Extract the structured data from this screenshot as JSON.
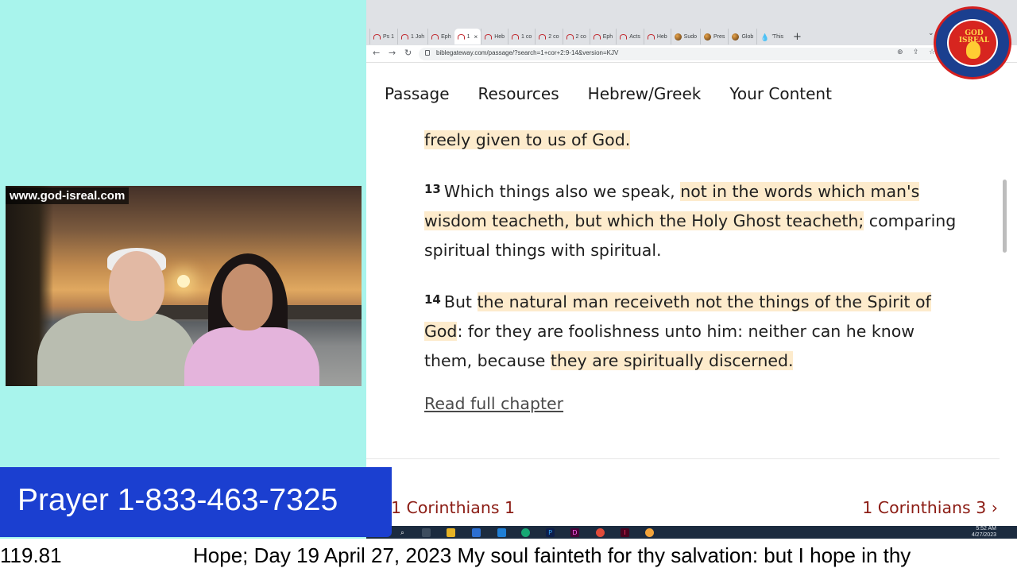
{
  "browser": {
    "tabs": [
      {
        "label": "Ps 1",
        "icon": "arc"
      },
      {
        "label": "1 Joh",
        "icon": "arc"
      },
      {
        "label": "Eph",
        "icon": "arc"
      },
      {
        "label": "1",
        "icon": "arc",
        "active": true
      },
      {
        "label": "Heb",
        "icon": "arc"
      },
      {
        "label": "1 co",
        "icon": "arc"
      },
      {
        "label": "2 co",
        "icon": "arc"
      },
      {
        "label": "2 co",
        "icon": "arc"
      },
      {
        "label": "Eph",
        "icon": "arc"
      },
      {
        "label": "Acts",
        "icon": "arc"
      },
      {
        "label": "Heb",
        "icon": "arc"
      },
      {
        "label": "Sudo",
        "icon": "globe"
      },
      {
        "label": "Pres",
        "icon": "globe"
      },
      {
        "label": "Glob",
        "icon": "globe"
      },
      {
        "label": "'This",
        "icon": "drop"
      }
    ],
    "new_tab_label": "+",
    "tab_close": "×",
    "tab_dropdown": "⌄",
    "url": "biblegateway.com/passage/?search=1+cor+2:9-14&version=KJV",
    "back": "←",
    "forward": "→",
    "reload": "↻"
  },
  "site_menu": [
    "Passage",
    "Resources",
    "Hebrew/Greek",
    "Your Content"
  ],
  "passage": {
    "continuation": "freely given to us of God.",
    "verses": [
      {
        "num": "13",
        "segments": [
          {
            "text": "Which things also we speak, ",
            "hl": false
          },
          {
            "text": "not in the words which man's wisdom teacheth, but which the Holy Ghost teacheth;",
            "hl": true
          },
          {
            "text": " comparing spiritual things with spiritual.",
            "hl": false
          }
        ]
      },
      {
        "num": "14",
        "segments": [
          {
            "text": "But ",
            "hl": false
          },
          {
            "text": "the natural man receiveth not the things of the Spirit of God",
            "hl": true
          },
          {
            "text": ": for they are foolishness unto him: neither can he know them, because ",
            "hl": false
          },
          {
            "text": "they are spiritually discerned.",
            "hl": true
          }
        ]
      }
    ],
    "read_full": "Read full chapter",
    "prev_chapter": "1 Corinthians 1",
    "next_chapter": "1 Corinthians 3",
    "next_arrow": "›"
  },
  "taskbar": {
    "clock_time": "5:52 AM",
    "clock_date": "4/27/2023"
  },
  "seal": {
    "text_top": "GOD",
    "text_bottom": "ISREAL"
  },
  "webcam": {
    "site_label": "www.god-isreal.com"
  },
  "prayer_banner": "Prayer 1-833-463-7325",
  "ticker": {
    "left": "119.81",
    "main": "Hope; Day 19 April 27, 2023 My soul fainteth for thy salvation: but I hope in thy"
  },
  "colors": {
    "background": "#a8f4ec",
    "highlight": "#fdebcc",
    "banner": "#1b3fd0",
    "chapter_link": "#8c1d15"
  }
}
